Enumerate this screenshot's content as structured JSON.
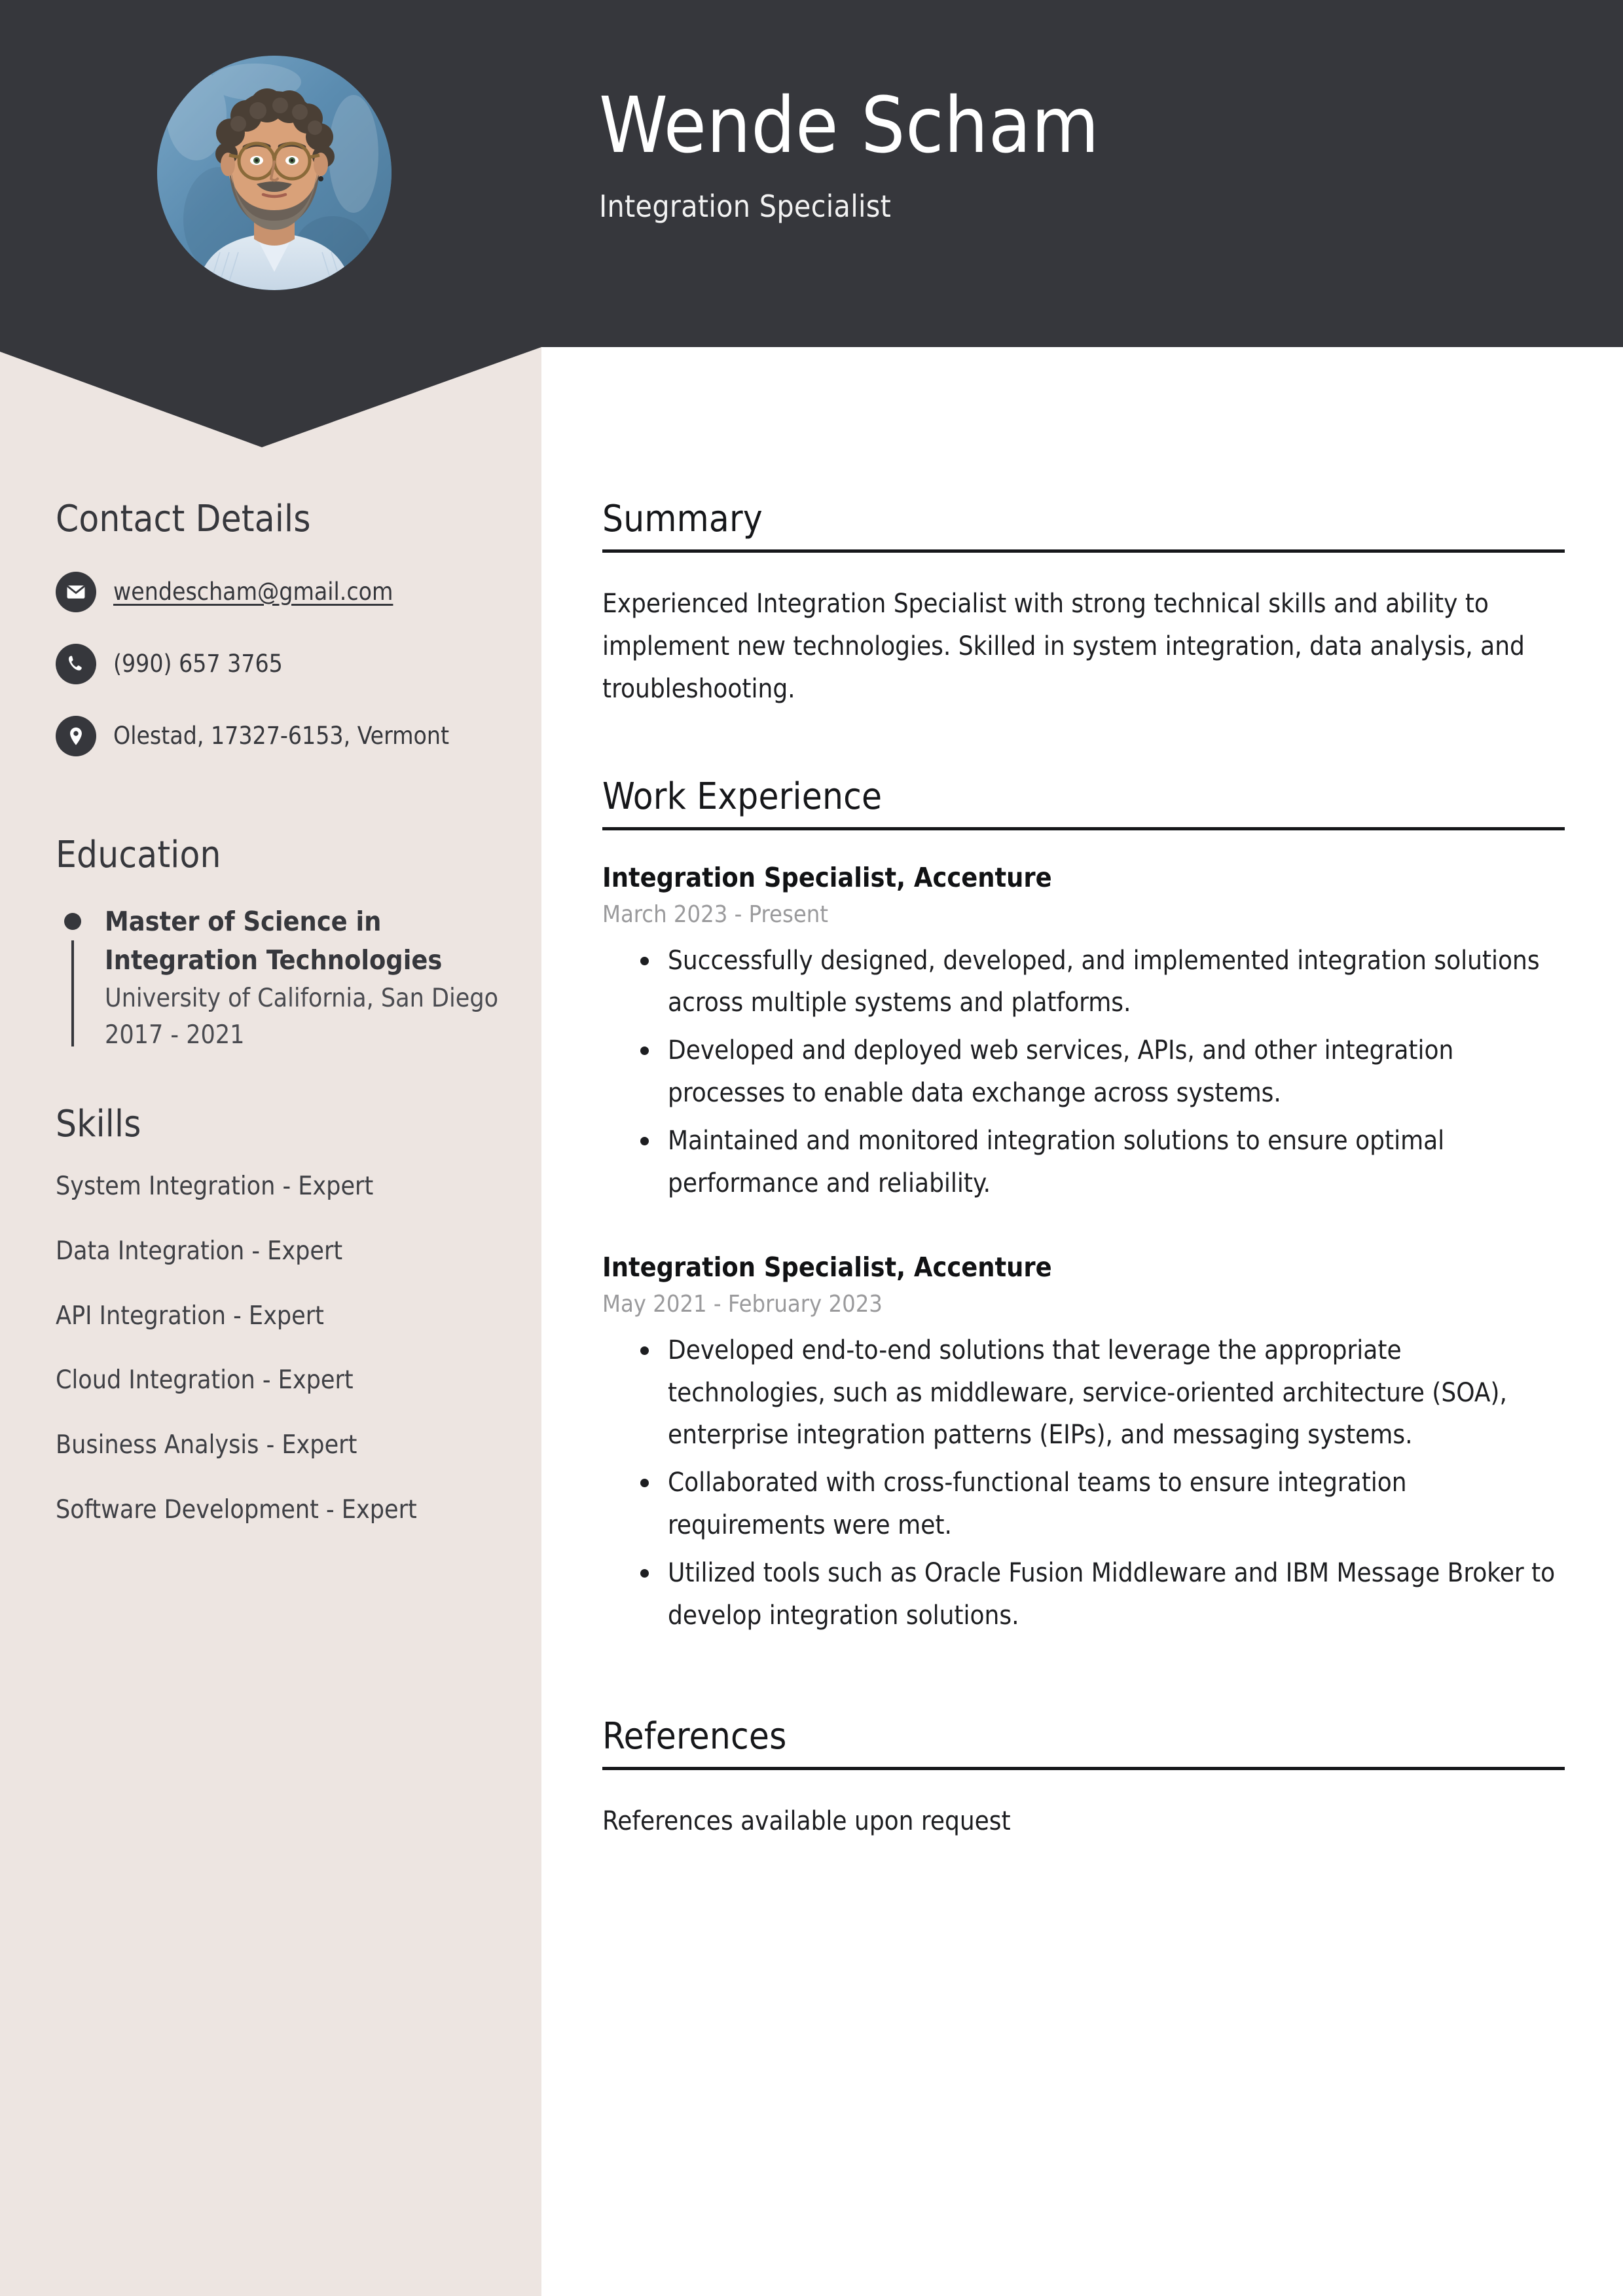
{
  "header": {
    "name": "Wende Scham",
    "job_title": "Integration Specialist",
    "avatar_alt": "portrait-photo",
    "bg_color": "#36373C"
  },
  "sidebar": {
    "bg_color": "#EDE5E1",
    "contact": {
      "heading": "Contact Details",
      "items": [
        {
          "icon": "envelope-icon",
          "text": "wendescham@gmail.com",
          "is_link": true
        },
        {
          "icon": "phone-icon",
          "text": "(990) 657 3765",
          "is_link": false
        },
        {
          "icon": "location-pin-icon",
          "text": "Olestad, 17327-6153, Vermont",
          "is_link": false
        }
      ]
    },
    "education": {
      "heading": "Education",
      "entries": [
        {
          "degree": "Master of Science in Integration Technologies",
          "school": "University of California, San Diego",
          "years": "2017 - 2021"
        }
      ]
    },
    "skills": {
      "heading": "Skills",
      "items": [
        "System Integration - Expert",
        "Data Integration - Expert",
        "API Integration - Expert",
        "Cloud Integration - Expert",
        "Business Analysis - Expert",
        "Software Development - Expert"
      ]
    }
  },
  "main": {
    "summary": {
      "heading": "Summary",
      "text": "Experienced Integration Specialist with strong technical skills and ability to implement new technologies. Skilled in system integration, data analysis, and troubleshooting."
    },
    "work_experience": {
      "heading": "Work Experience",
      "jobs": [
        {
          "role": "Integration Specialist, Accenture",
          "dates": "March 2023 - Present",
          "bullets": [
            "Successfully designed, developed, and implemented integration solutions across multiple systems and platforms.",
            "Developed and deployed web services, APIs, and other integration processes to enable data exchange across systems.",
            "Maintained and monitored integration solutions to ensure optimal performance and reliability."
          ]
        },
        {
          "role": "Integration Specialist, Accenture",
          "dates": "May 2021 - February 2023",
          "bullets": [
            "Developed end-to-end solutions that leverage the appropriate technologies, such as middleware, service-oriented architecture (SOA), enterprise integration patterns (EIPs), and messaging systems.",
            "Collaborated with cross-functional teams to ensure integration requirements were met.",
            "Utilized tools such as Oracle Fusion Middleware and IBM Message Broker to develop integration solutions."
          ]
        }
      ]
    },
    "references": {
      "heading": "References",
      "text": "References available upon request"
    }
  }
}
